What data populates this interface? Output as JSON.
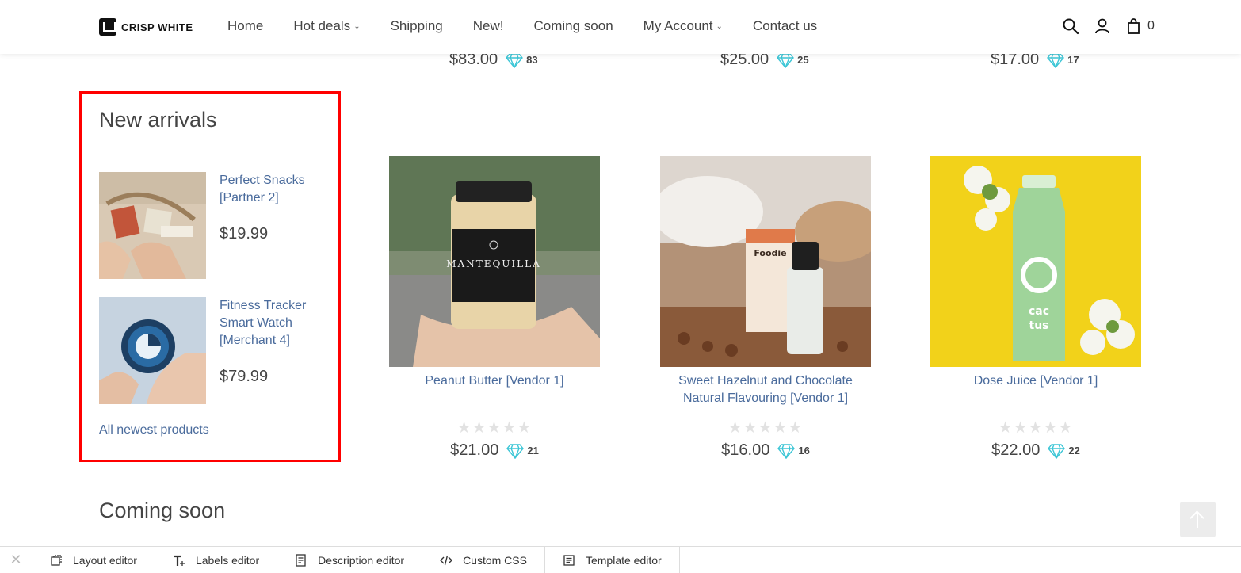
{
  "header": {
    "logo_text": "CRISP WHITE",
    "nav": [
      {
        "label": "Home",
        "dropdown": false
      },
      {
        "label": "Hot deals",
        "dropdown": true
      },
      {
        "label": "Shipping",
        "dropdown": false
      },
      {
        "label": "New!",
        "dropdown": false
      },
      {
        "label": "Coming soon",
        "dropdown": false
      },
      {
        "label": "My Account",
        "dropdown": true
      },
      {
        "label": "Contact us",
        "dropdown": false
      }
    ],
    "cart_count": "0"
  },
  "top_row": [
    {
      "price": "$83.00",
      "points": "83"
    },
    {
      "price": "$25.00",
      "points": "25"
    },
    {
      "price": "$17.00",
      "points": "17"
    }
  ],
  "new_arrivals": {
    "title": "New arrivals",
    "items": [
      {
        "name": "Perfect Snacks [Partner 2]",
        "price": "$19.99"
      },
      {
        "name": "Fitness Tracker Smart Watch [Merchant 4]",
        "price": "$79.99"
      }
    ],
    "all_link": "All newest products"
  },
  "products": [
    {
      "name": "Peanut Butter [Vendor 1]",
      "price": "$21.00",
      "points": "21"
    },
    {
      "name": "Sweet Hazelnut and Chocolate Natural Flavouring [Vendor 1]",
      "price": "$16.00",
      "points": "16"
    },
    {
      "name": "Dose Juice [Vendor 1]",
      "price": "$22.00",
      "points": "22"
    }
  ],
  "stars_text": "★★★★★",
  "section_title": "Coming soon",
  "toolbar": {
    "items": [
      {
        "label": "Layout editor",
        "icon": "layout-icon"
      },
      {
        "label": "Labels editor",
        "icon": "text-icon"
      },
      {
        "label": "Description editor",
        "icon": "document-icon"
      },
      {
        "label": "Custom CSS",
        "icon": "code-icon"
      },
      {
        "label": "Template editor",
        "icon": "template-icon"
      }
    ]
  },
  "colors": {
    "accent_link": "#4a6b9c",
    "highlight_border": "#ff0000",
    "gem": "#3cc6d6"
  }
}
